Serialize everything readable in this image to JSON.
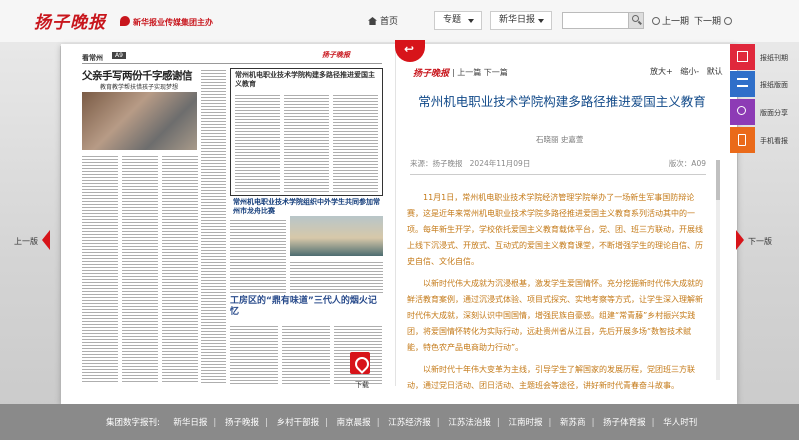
{
  "header": {
    "logo": "扬子晚报",
    "logo_sub": "新华报业传媒集团主办",
    "home": "首页",
    "topic": "专题",
    "paper_select": "新华日报",
    "search_placeholder": "",
    "prev_page": "上一期",
    "next_page": "下一期"
  },
  "left_page": {
    "edition": "看常州",
    "edition_no": "A9",
    "masthead": "扬子晚报",
    "headline1": "父亲手写两份千字感谢信",
    "headline1_sub": "教育教学帮扶惜孩子实现梦想",
    "box_headline": "常州机电职业技术学院构建多路径推进爱国主义教育",
    "box2_headline": "常州机电职业技术学院组织中外学生共同参加常州市龙舟比赛",
    "headline2": "工房区的“鼎有味道”三代人的烟火记忆",
    "pdf_label": "下载"
  },
  "article": {
    "logo": "扬子晚报",
    "nav": "上一篇 下一篇",
    "zoom_in": "放大+",
    "zoom_out": "缩小-",
    "default": "默认",
    "title": "常州机电职业技术学院构建多路径推进爱国主义教育",
    "author": "石晓丽 史嘉萱",
    "source": "来源：扬子晚报",
    "date": "2024年11月09日",
    "edition": "版次：A09",
    "paragraphs": [
      "11月1日，常州机电职业技术学院经济管理学院举办了一场新生军事国防辩论赛，这是近年来常州机电职业技术学院多路径推进爱国主义教育系列活动其中的一项。每年新生开学，学校依托爱国主义教育载体平台，党、团、班三方联动，开展线上线下沉浸式、开放式、互动式的爱国主义教育课堂，不断增强学生的理论自信、历史自信、文化自信。",
      "以新时代伟大成就为沉浸根基，激发学生爱国情怀。充分挖掘新时代伟大成就的鲜活教育案例，通过沉浸式体验、项目式探究、实地考察等方式，让学生深入理解新时代伟大成就，深刻认识中国国情，增强民族自豪感。组建“常青藤”乡村振兴实践团，将爱国情怀转化为实际行动，远赴贵州省从江县，先后开展多场“数智技术赋能，特色农产品电商助力行动”。",
      "以新时代十年伟大变革为主线，引导学生了解国家的发展历程，党团班三方联动，通过党日活动、团日活动、主题班会等途径，讲好新时代青春奋斗故事。"
    ]
  },
  "side": {
    "prev": "上一版",
    "next": "下一版"
  },
  "toolbar": [
    {
      "label": "报纸刊期",
      "icon": "calendar-icon",
      "color": "#e0283c"
    },
    {
      "label": "报纸版面",
      "icon": "list-icon",
      "color": "#2f6fc9"
    },
    {
      "label": "版面分享",
      "icon": "share-icon",
      "color": "#8d3bb5"
    },
    {
      "label": "手机看报",
      "icon": "mobile-icon",
      "color": "#ea6a1a"
    }
  ],
  "footer": {
    "label": "集团数字报刊:",
    "links": [
      "新华日报",
      "扬子晚报",
      "乡村干部报",
      "南京晨报",
      "江苏经济报",
      "江苏法治报",
      "江南时报",
      "新苏商",
      "扬子体育报",
      "华人时刊"
    ]
  },
  "colors": {
    "brand_red": "#c8161d",
    "title_blue": "#134b8a",
    "body_orange": "#c47a18"
  }
}
